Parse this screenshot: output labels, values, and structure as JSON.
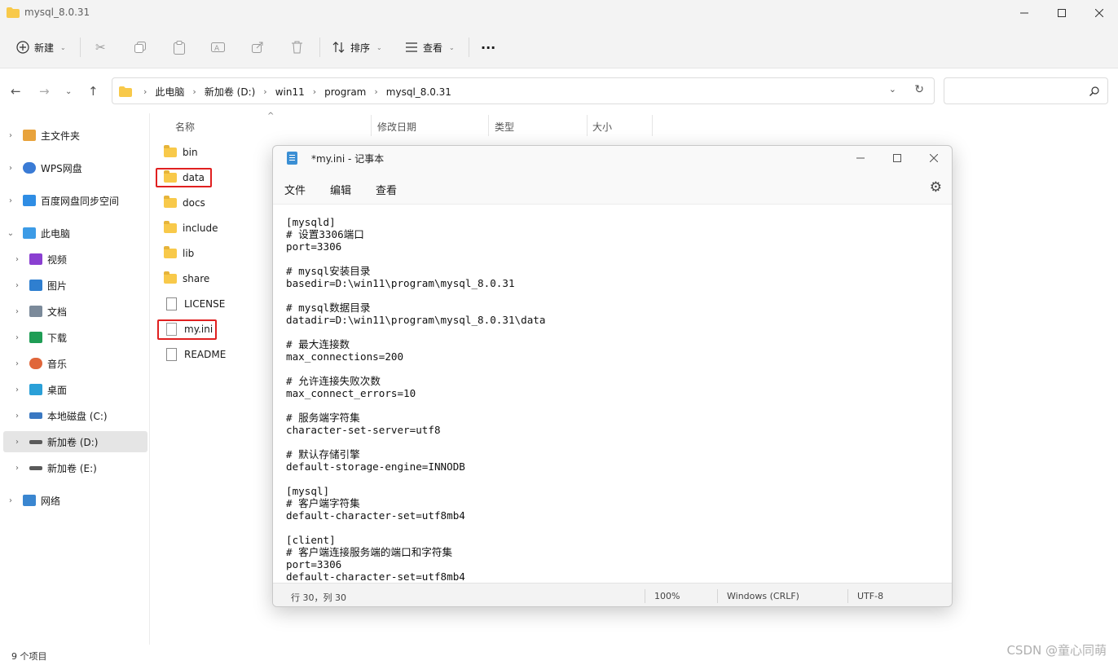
{
  "explorer": {
    "window_title": "mysql_8.0.31",
    "toolbar": {
      "new_label": "新建",
      "sort_label": "排序",
      "view_label": "查看",
      "more_label": "···"
    },
    "breadcrumbs": [
      "此电脑",
      "新加卷 (D:)",
      "win11",
      "program",
      "mysql_8.0.31"
    ],
    "sidebar": {
      "items": [
        {
          "label": "主文件夹",
          "icon": "home-icon",
          "color": "#e8a33c"
        },
        {
          "label": "WPS网盘",
          "icon": "cloud-icon",
          "color": "#3a7bd5"
        },
        {
          "label": "百度网盘同步空间",
          "icon": "baidu-sync-icon",
          "color": "#2f8de4"
        },
        {
          "label": "此电脑",
          "icon": "computer-icon",
          "color": "#3c9be6"
        },
        {
          "label": "视频",
          "icon": "video-icon",
          "color": "#8a3fd1"
        },
        {
          "label": "图片",
          "icon": "picture-icon",
          "color": "#2f7fd0"
        },
        {
          "label": "文档",
          "icon": "document-icon",
          "color": "#7b8a9a"
        },
        {
          "label": "下载",
          "icon": "download-icon",
          "color": "#1f9d55"
        },
        {
          "label": "音乐",
          "icon": "music-icon",
          "color": "#e0663a"
        },
        {
          "label": "桌面",
          "icon": "desktop-icon",
          "color": "#2aa0d8"
        },
        {
          "label": "本地磁盘 (C:)",
          "icon": "windows-drive-icon",
          "color": "#3a78c2"
        },
        {
          "label": "新加卷 (D:)",
          "icon": "drive-icon",
          "color": "#5a5a5a"
        },
        {
          "label": "新加卷 (E:)",
          "icon": "drive-icon",
          "color": "#5a5a5a"
        },
        {
          "label": "网络",
          "icon": "network-icon",
          "color": "#3a86d0"
        }
      ]
    },
    "columns": {
      "name": "名称",
      "modified": "修改日期",
      "type": "类型",
      "size": "大小"
    },
    "files": [
      {
        "name": "bin",
        "kind": "folder"
      },
      {
        "name": "data",
        "kind": "folder"
      },
      {
        "name": "docs",
        "kind": "folder"
      },
      {
        "name": "include",
        "kind": "folder"
      },
      {
        "name": "lib",
        "kind": "folder"
      },
      {
        "name": "share",
        "kind": "folder"
      },
      {
        "name": "LICENSE",
        "kind": "file"
      },
      {
        "name": "my.ini",
        "kind": "config"
      },
      {
        "name": "README",
        "kind": "file"
      }
    ],
    "status_count": "9 个项目"
  },
  "notepad": {
    "title": "*my.ini - 记事本",
    "menu": [
      "文件",
      "编辑",
      "查看"
    ],
    "content": "[mysqld]\n# 设置3306端口\nport=3306\n\n# mysql安装目录\nbasedir=D:\\win11\\program\\mysql_8.0.31\n\n# mysql数据目录\ndatadir=D:\\win11\\program\\mysql_8.0.31\\data\n\n# 最大连接数\nmax_connections=200\n\n# 允许连接失败次数\nmax_connect_errors=10\n\n# 服务端字符集\ncharacter-set-server=utf8\n\n# 默认存储引擎\ndefault-storage-engine=INNODB\n\n[mysql]\n# 客户端字符集\ndefault-character-set=utf8mb4\n\n[client]\n# 客户端连接服务端的端口和字符集\nport=3306\ndefault-character-set=utf8mb4",
    "status": {
      "position": "行 30，列 30",
      "zoom": "100%",
      "line_ending": "Windows (CRLF)",
      "encoding": "UTF-8"
    }
  },
  "watermark": "CSDN @童心同萌",
  "colors": {
    "highlight": "#e02020",
    "folder": "#f8c94a",
    "selected_row": "#e5e5e5"
  }
}
